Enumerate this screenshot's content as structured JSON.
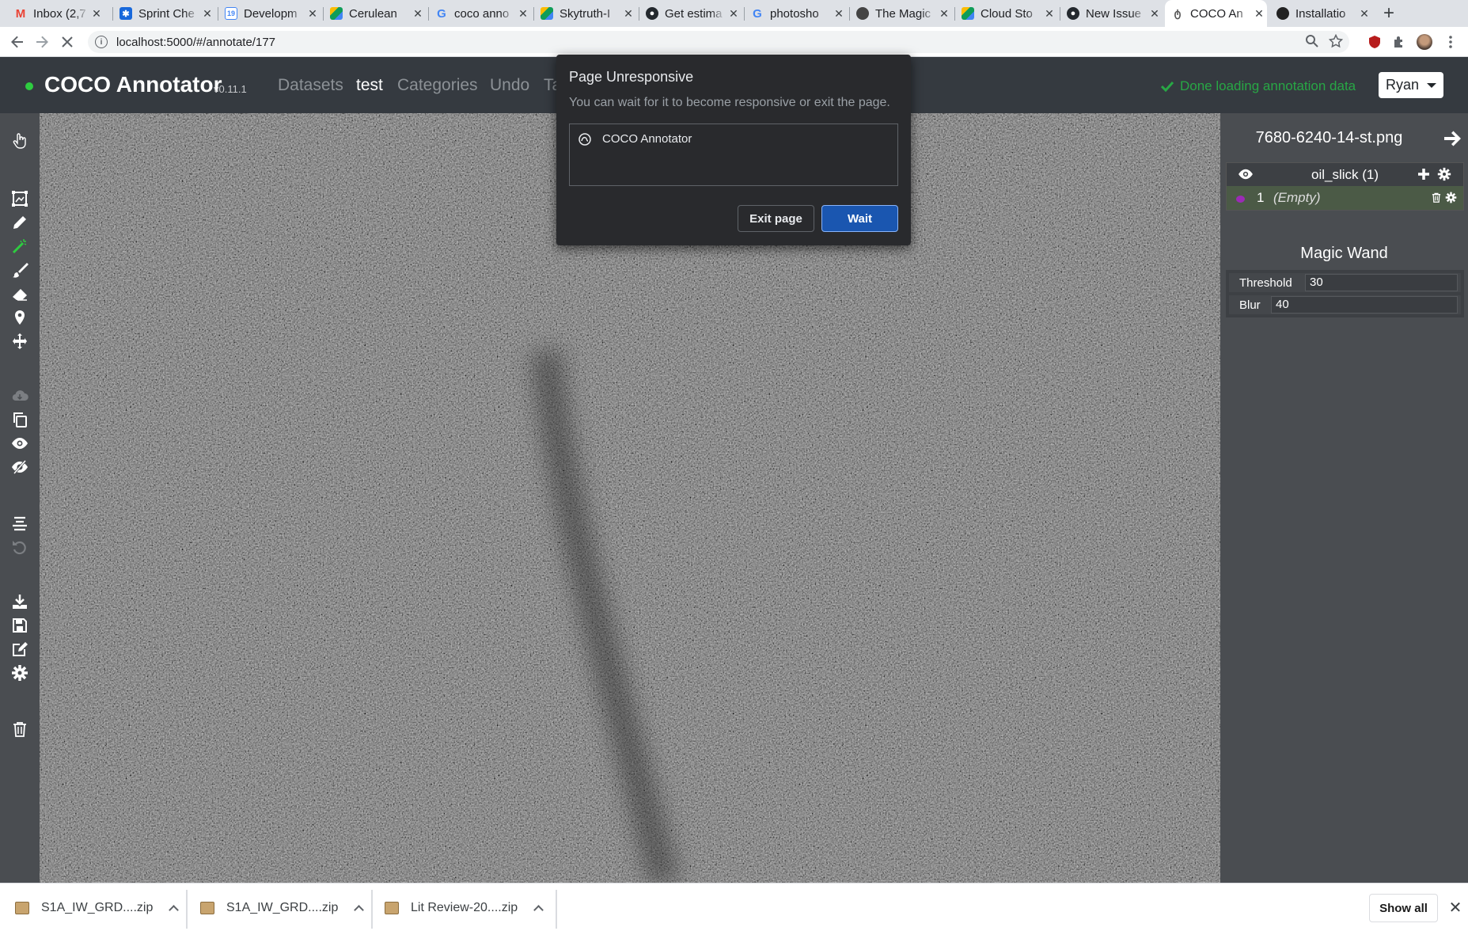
{
  "browser": {
    "tabs": [
      {
        "label": "Inbox (2,7",
        "favicon": "gmail-icon",
        "color": "#ea4335"
      },
      {
        "label": "Sprint Che",
        "favicon": "confluence-icon",
        "color": "#1868db"
      },
      {
        "label": "Developm",
        "favicon": "calendar-icon",
        "color": "#4285f4"
      },
      {
        "label": "Cerulean",
        "favicon": "drive-icon",
        "color": "#0f9d58"
      },
      {
        "label": "coco anno",
        "favicon": "google-icon",
        "color": "#4285f4"
      },
      {
        "label": "Skytruth-I",
        "favicon": "drive-icon",
        "color": "#0f9d58"
      },
      {
        "label": "Get estima",
        "favicon": "github-icon",
        "color": "#24292e"
      },
      {
        "label": "photosho",
        "favicon": "google-icon",
        "color": "#4285f4"
      },
      {
        "label": "The Magic",
        "favicon": "site-icon",
        "color": "#444444"
      },
      {
        "label": "Cloud Sto",
        "favicon": "drive-icon",
        "color": "#0f9d58"
      },
      {
        "label": "New Issue",
        "favicon": "github-icon",
        "color": "#24292e"
      },
      {
        "label": "COCO An",
        "favicon": "coco-icon",
        "color": "#888888",
        "active": true
      },
      {
        "label": "Installatio",
        "favicon": "site-icon",
        "color": "#222222"
      }
    ],
    "url": "localhost:5000/#/annotate/177"
  },
  "app": {
    "brand": "COCO Annotator",
    "version": "v0.11.1",
    "nav": [
      "Datasets",
      "test",
      "Categories",
      "Undo",
      "Ta"
    ],
    "status": "Done loading annotation data",
    "user": "Ryan"
  },
  "panel": {
    "filename": "7680-6240-14-st.png",
    "category": {
      "name": "oil_slick (1)"
    },
    "annotation": {
      "id": "1",
      "label": "(Empty)",
      "color": "#9b2bb5"
    },
    "tool_title": "Magic Wand",
    "settings": [
      {
        "label": "Threshold",
        "value": "30"
      },
      {
        "label": "Blur",
        "value": "40"
      }
    ]
  },
  "dialog": {
    "title": "Page Unresponsive",
    "message": "You can wait for it to become responsive or exit the page.",
    "item": "COCO Annotator",
    "exit_label": "Exit page",
    "wait_label": "Wait"
  },
  "downloads": {
    "items": [
      "S1A_IW_GRD....zip",
      "S1A_IW_GRD....zip",
      "Lit Review-20....zip"
    ],
    "show_all": "Show all"
  }
}
